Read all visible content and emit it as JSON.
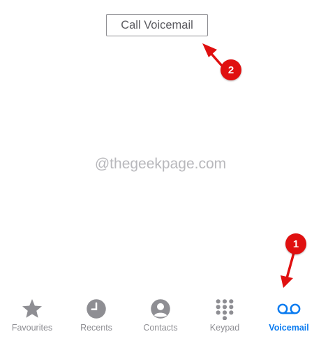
{
  "call_voicemail_label": "Call Voicemail",
  "watermark": "@thegeekpage.com",
  "annotations": {
    "step1": "1",
    "step2": "2"
  },
  "tabs": [
    {
      "label": "Favourites",
      "icon": "star-icon"
    },
    {
      "label": "Recents",
      "icon": "clock-icon"
    },
    {
      "label": "Contacts",
      "icon": "person-circle-icon"
    },
    {
      "label": "Keypad",
      "icon": "keypad-icon"
    },
    {
      "label": "Voicemail",
      "icon": "voicemail-icon",
      "active": true
    }
  ],
  "colors": {
    "active": "#0a7bf0",
    "inactive": "#8e8e93",
    "annotation": "#e01010"
  }
}
